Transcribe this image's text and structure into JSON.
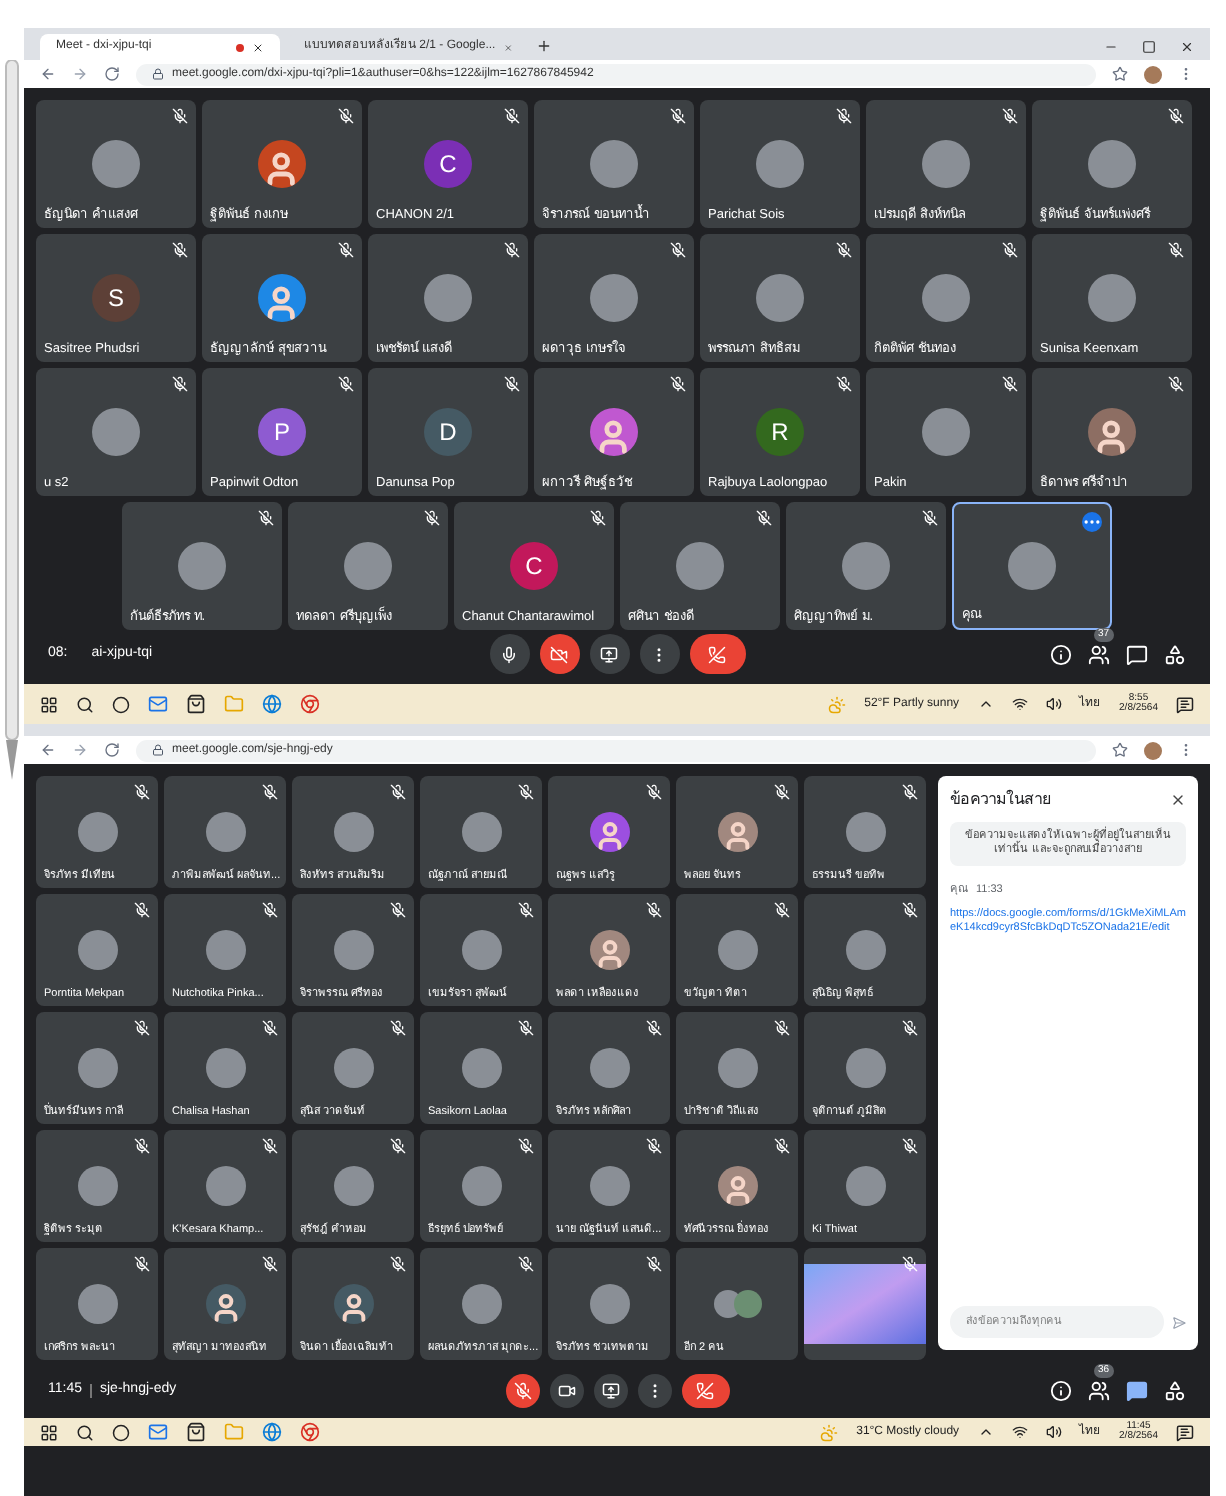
{
  "top": {
    "tabs": [
      {
        "title": "Meet - dxi-xjpu-tqi",
        "selected": true,
        "recording": true
      },
      {
        "title": "แบบทดสอบหลังเรียน 2/1 - Google...",
        "selected": false,
        "recording": false
      }
    ],
    "url": "meet.google.com/dxi-xjpu-tqi?pli=1&authuser=0&hs=122&ijlm=1627867845942",
    "rows": [
      [
        {
          "name": "ธัญนิดา คำแสงศ",
          "kind": "photo",
          "muted": true
        },
        {
          "name": "ฐิติพันธ์ กงเกษ",
          "kind": "person",
          "color": "#c5461f",
          "muted": true
        },
        {
          "name": "CHANON 2/1",
          "kind": "letter",
          "letter": "C",
          "color": "#7b2fb5",
          "muted": true
        },
        {
          "name": "จิราภรณ์ ขอนทาน้ำ",
          "kind": "photo",
          "muted": true
        },
        {
          "name": "Parichat Sois",
          "kind": "photo",
          "muted": true
        },
        {
          "name": "เปรมฤดี สิงห์ทนิล",
          "kind": "photo",
          "muted": true
        },
        {
          "name": "ฐิติพันธ์ จันทร์แพ่งศรี",
          "kind": "photo",
          "muted": true
        }
      ],
      [
        {
          "name": "Sasitree Phudsri",
          "kind": "letter",
          "letter": "S",
          "color": "#5d4037",
          "muted": true
        },
        {
          "name": "ธัญญาลักษ์ สุขสวาน",
          "kind": "person",
          "color": "#1e88e5",
          "muted": true
        },
        {
          "name": "เพชรัตน์ แสงดี",
          "kind": "photo",
          "muted": true
        },
        {
          "name": "ผดาวุธ เกษรใจ",
          "kind": "photo",
          "muted": true
        },
        {
          "name": "พรรณภา สิทธิสม",
          "kind": "photo",
          "muted": true
        },
        {
          "name": "กิตติพัศ ชันทอง",
          "kind": "photo",
          "muted": true
        },
        {
          "name": "Sunisa Keenxam",
          "kind": "photo",
          "muted": true
        }
      ],
      [
        {
          "name": "u s2",
          "kind": "photo",
          "muted": true
        },
        {
          "name": "Papinwit Odton",
          "kind": "letter",
          "letter": "P",
          "color": "#8e5bd1",
          "muted": true
        },
        {
          "name": "Danunsa Pop",
          "kind": "letter",
          "letter": "D",
          "color": "#455a64",
          "muted": true
        },
        {
          "name": "ผกาวรี ศิษฐ์ธวัช",
          "kind": "person",
          "color": "#c058d0",
          "muted": true
        },
        {
          "name": "Rajbuya Laolongpao",
          "kind": "letter",
          "letter": "R",
          "color": "#33691e",
          "muted": true
        },
        {
          "name": "Pakin",
          "kind": "photo",
          "muted": true
        },
        {
          "name": "ธิดาพร ศรีจำปา",
          "kind": "person",
          "color": "#8d6e63",
          "muted": true
        }
      ],
      [
        {
          "name": "กันต์ธีรภัทร ท.",
          "kind": "photo",
          "muted": true
        },
        {
          "name": "ทดลดา ศรีบุญเพ็ง",
          "kind": "photo",
          "muted": true
        },
        {
          "name": "Chanut Chantarawimol",
          "kind": "letter",
          "letter": "C",
          "color": "#c2185b",
          "muted": true
        },
        {
          "name": "ศศินา ช่องดี",
          "kind": "photo",
          "muted": true
        },
        {
          "name": "ศิญญาทิพย์ ม.",
          "kind": "photo",
          "muted": true
        },
        {
          "name": "คุณ",
          "kind": "photo",
          "muted": false,
          "selected": true
        }
      ]
    ],
    "time": "08:",
    "code": "ai-xjpu-tqi",
    "participants": "37",
    "controls": [
      {
        "kind": "mic",
        "on": true
      },
      {
        "kind": "camera",
        "on": false
      },
      {
        "kind": "present",
        "on": true
      },
      {
        "kind": "more",
        "on": true
      },
      {
        "kind": "end"
      }
    ],
    "chat_open": false,
    "taskbar": {
      "weather": "52°F Partly sunny",
      "lang": "ไทย",
      "time": "8:55",
      "date": "2/8/2564"
    }
  },
  "bottom": {
    "url": "meet.google.com/sje-hngj-edy",
    "rows": [
      [
        {
          "name": "จิรภัทร มีเทียน",
          "kind": "photo",
          "muted": true
        },
        {
          "name": "ภาพิมลพัฒน์ ผลจันท...",
          "kind": "photo",
          "muted": true
        },
        {
          "name": "สิงหัทร สวนส้มริม",
          "kind": "photo",
          "muted": true
        },
        {
          "name": "ณัฐภาณ์ สายมณี",
          "kind": "photo",
          "muted": true
        },
        {
          "name": "ณฐพร แสวิรู",
          "kind": "person",
          "color": "#9c4fe0",
          "muted": true
        },
        {
          "name": "พลอย จันทร",
          "kind": "person",
          "color": "#a1887f",
          "muted": true
        },
        {
          "name": "ธรรมนรี ขอทิพ",
          "kind": "photo",
          "muted": true
        }
      ],
      [
        {
          "name": "Porntita Mekpan",
          "kind": "photo",
          "muted": true
        },
        {
          "name": "Nutchotika Pinka...",
          "kind": "photo",
          "muted": true
        },
        {
          "name": "จิราพรรณ ศรีทอง",
          "kind": "photo",
          "muted": true
        },
        {
          "name": "เขมรัจรา สุพัฒน์",
          "kind": "photo",
          "muted": true
        },
        {
          "name": "พลดา เหลืองแดง",
          "kind": "person",
          "color": "#a1887f",
          "muted": true
        },
        {
          "name": "ขวัญตา ทิตา",
          "kind": "photo",
          "muted": true
        },
        {
          "name": "สุนิธิญ พิสุทธ์",
          "kind": "photo",
          "muted": true
        }
      ],
      [
        {
          "name": "ปิ่นทร์มีนทร กาลี",
          "kind": "photo",
          "muted": true
        },
        {
          "name": "Chalisa Hashan",
          "kind": "photo",
          "muted": true
        },
        {
          "name": "สุนิส วาดจันท์",
          "kind": "photo",
          "muted": true
        },
        {
          "name": "Sasikorn Laolaa",
          "kind": "photo",
          "muted": true
        },
        {
          "name": "จิรภัทร หลักศิลา",
          "kind": "photo",
          "muted": true
        },
        {
          "name": "ปาริชาติ วิถีแสง",
          "kind": "photo",
          "muted": true
        },
        {
          "name": "จุติกานต์ ภูมิสิต",
          "kind": "photo",
          "muted": true
        }
      ],
      [
        {
          "name": "ฐิติพร ระมุต",
          "kind": "photo",
          "muted": true
        },
        {
          "name": "K'Kesara Khamp...",
          "kind": "photo",
          "muted": true
        },
        {
          "name": "สุรัชฎ์ คำหอม",
          "kind": "photo",
          "muted": true
        },
        {
          "name": "ธีรยุทธ์ ปอทรัพย์",
          "kind": "photo",
          "muted": true
        },
        {
          "name": "นาย ณัฐนันท์ แสนดิ...",
          "kind": "photo",
          "muted": true
        },
        {
          "name": "ทัศนีวรรณ ยิ่งทอง",
          "kind": "person",
          "color": "#a1887f",
          "muted": true
        },
        {
          "name": "Ki Thiwat",
          "kind": "photo",
          "muted": true
        }
      ],
      [
        {
          "name": "เกศริกร พละนา",
          "kind": "photo",
          "muted": true
        },
        {
          "name": "สุทัสญา มาทองสนิท",
          "kind": "person",
          "color": "#455a64",
          "muted": true
        },
        {
          "name": "จินดา เยื้องเฉลิมท้า",
          "kind": "person",
          "color": "#455a64",
          "muted": true
        },
        {
          "name": "ผลนดภัทรภาส มุกดะ...",
          "kind": "photo",
          "muted": true
        },
        {
          "name": "จิรภัทร ชวเทพตาม",
          "kind": "photo",
          "muted": true
        },
        {
          "name": "อีก 2 คน",
          "kind": "group",
          "muted": false
        },
        {
          "kind": "video",
          "muted": true
        }
      ]
    ],
    "time": "11:45",
    "code": "sje-hngj-edy",
    "participants": "36",
    "controls": [
      {
        "kind": "mic",
        "on": false
      },
      {
        "kind": "camera",
        "on": true
      },
      {
        "kind": "present",
        "on": true
      },
      {
        "kind": "more",
        "on": true
      },
      {
        "kind": "end"
      }
    ],
    "chat_open": true,
    "chat": {
      "title": "ข้อความในสาย",
      "notice": "ข้อความจะแสดงให้เฉพาะผู้ที่อยู่ในสายเห็นเท่านั้น และจะถูกลบเมื่อวางสาย",
      "sender": "คุณ",
      "time": "11:33",
      "link": "https://docs.google.com/forms/d/1GkMeXiMLAmeK14kcd9cyr8SfcBkDqDTc5ZONada21E/edit",
      "placeholder": "ส่งข้อความถึงทุกคน"
    },
    "taskbar": {
      "weather": "31°C Mostly cloudy",
      "lang": "ไทย",
      "time": "11:45",
      "date": "2/8/2564"
    }
  }
}
